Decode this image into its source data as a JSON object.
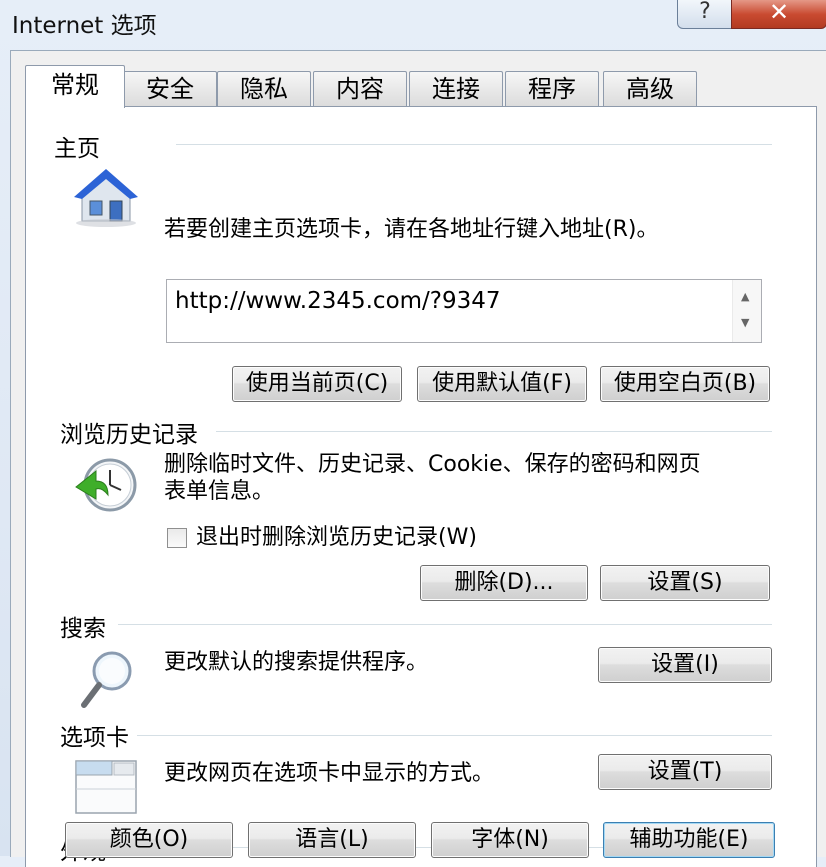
{
  "window": {
    "title": "Internet 选项",
    "help_glyph": "?",
    "close_glyph": "✕"
  },
  "tabs": [
    {
      "label": "常规",
      "active": true
    },
    {
      "label": "安全"
    },
    {
      "label": "隐私"
    },
    {
      "label": "内容"
    },
    {
      "label": "连接"
    },
    {
      "label": "程序"
    },
    {
      "label": "高级"
    }
  ],
  "home": {
    "label": "主页",
    "description": "若要创建主页选项卡，请在各地址行键入地址(R)。",
    "url": "http://www.2345.com/?9347",
    "buttons": {
      "use_current": "使用当前页(C)",
      "use_default": "使用默认值(F)",
      "use_blank": "使用空白页(B)"
    }
  },
  "history": {
    "label": "浏览历史记录",
    "description_line1": "删除临时文件、历史记录、Cookie、保存的密码和网页",
    "description_line2": "表单信息。",
    "checkbox_label": "退出时删除浏览历史记录(W)",
    "checkbox_checked": false,
    "buttons": {
      "delete": "删除(D)...",
      "settings": "设置(S)"
    }
  },
  "search": {
    "label": "搜索",
    "description": "更改默认的搜索提供程序。",
    "settings": "设置(I)"
  },
  "tabsec": {
    "label": "选项卡",
    "description": "更改网页在选项卡中显示的方式。",
    "settings": "设置(T)"
  },
  "appearance": {
    "label": "外观",
    "buttons": {
      "colors": "颜色(O)",
      "languages": "语言(L)",
      "fonts": "字体(N)",
      "accessibility": "辅助功能(E)"
    }
  },
  "colors": {
    "accent_blue": "#2a6fd0",
    "panel_bg": "#ffffff",
    "dialog_bg": "#f0f0f0"
  }
}
